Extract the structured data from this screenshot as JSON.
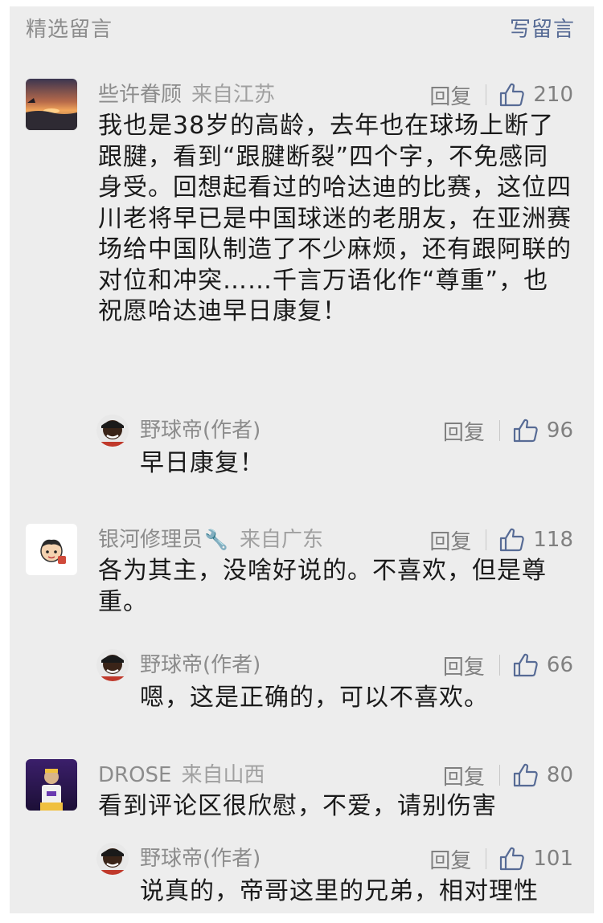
{
  "header": {
    "title": "精选留言",
    "write_label": "写留言"
  },
  "comments": [
    {
      "name": "些许眷顾",
      "from": "来自江苏",
      "reply_label": "回复",
      "likes": "210",
      "text": "我也是38岁的高龄，去年也在球场上断了跟腱，看到“跟腱断裂”四个字，不免感同身受。回想起看过的哈达迪的比赛，这位四川老将早已是中国球迷的老朋友，在亚洲赛场给中国队制造了不少麻烦，还有跟阿联的对位和冲突……千言万语化作“尊重”，也祝愿哈达迪早日康复！",
      "author_reply": {
        "name": "野球帝(作者)",
        "reply_label": "回复",
        "likes": "96",
        "text": "早日康复！"
      }
    },
    {
      "name": "银河修理员",
      "name_emoji": "🔧",
      "from": "来自广东",
      "reply_label": "回复",
      "likes": "118",
      "text": "各为其主，没啥好说的。不喜欢，但是尊重。",
      "author_reply": {
        "name": "野球帝(作者)",
        "reply_label": "回复",
        "likes": "66",
        "text": "嗯，这是正确的，可以不喜欢。"
      }
    },
    {
      "name": "DROSE",
      "from": "来自山西",
      "reply_label": "回复",
      "likes": "80",
      "text": "看到评论区很欣慰，不爱，请别伤害",
      "author_reply": {
        "name": "野球帝(作者)",
        "reply_label": "回复",
        "likes": "101",
        "text": "说真的，帝哥这里的兄弟，相对理性"
      }
    }
  ],
  "colors": {
    "link": "#576b95",
    "meta": "#8c8c8c",
    "background": "#ededed"
  },
  "icons": {
    "like": "thumbs-up-icon"
  }
}
